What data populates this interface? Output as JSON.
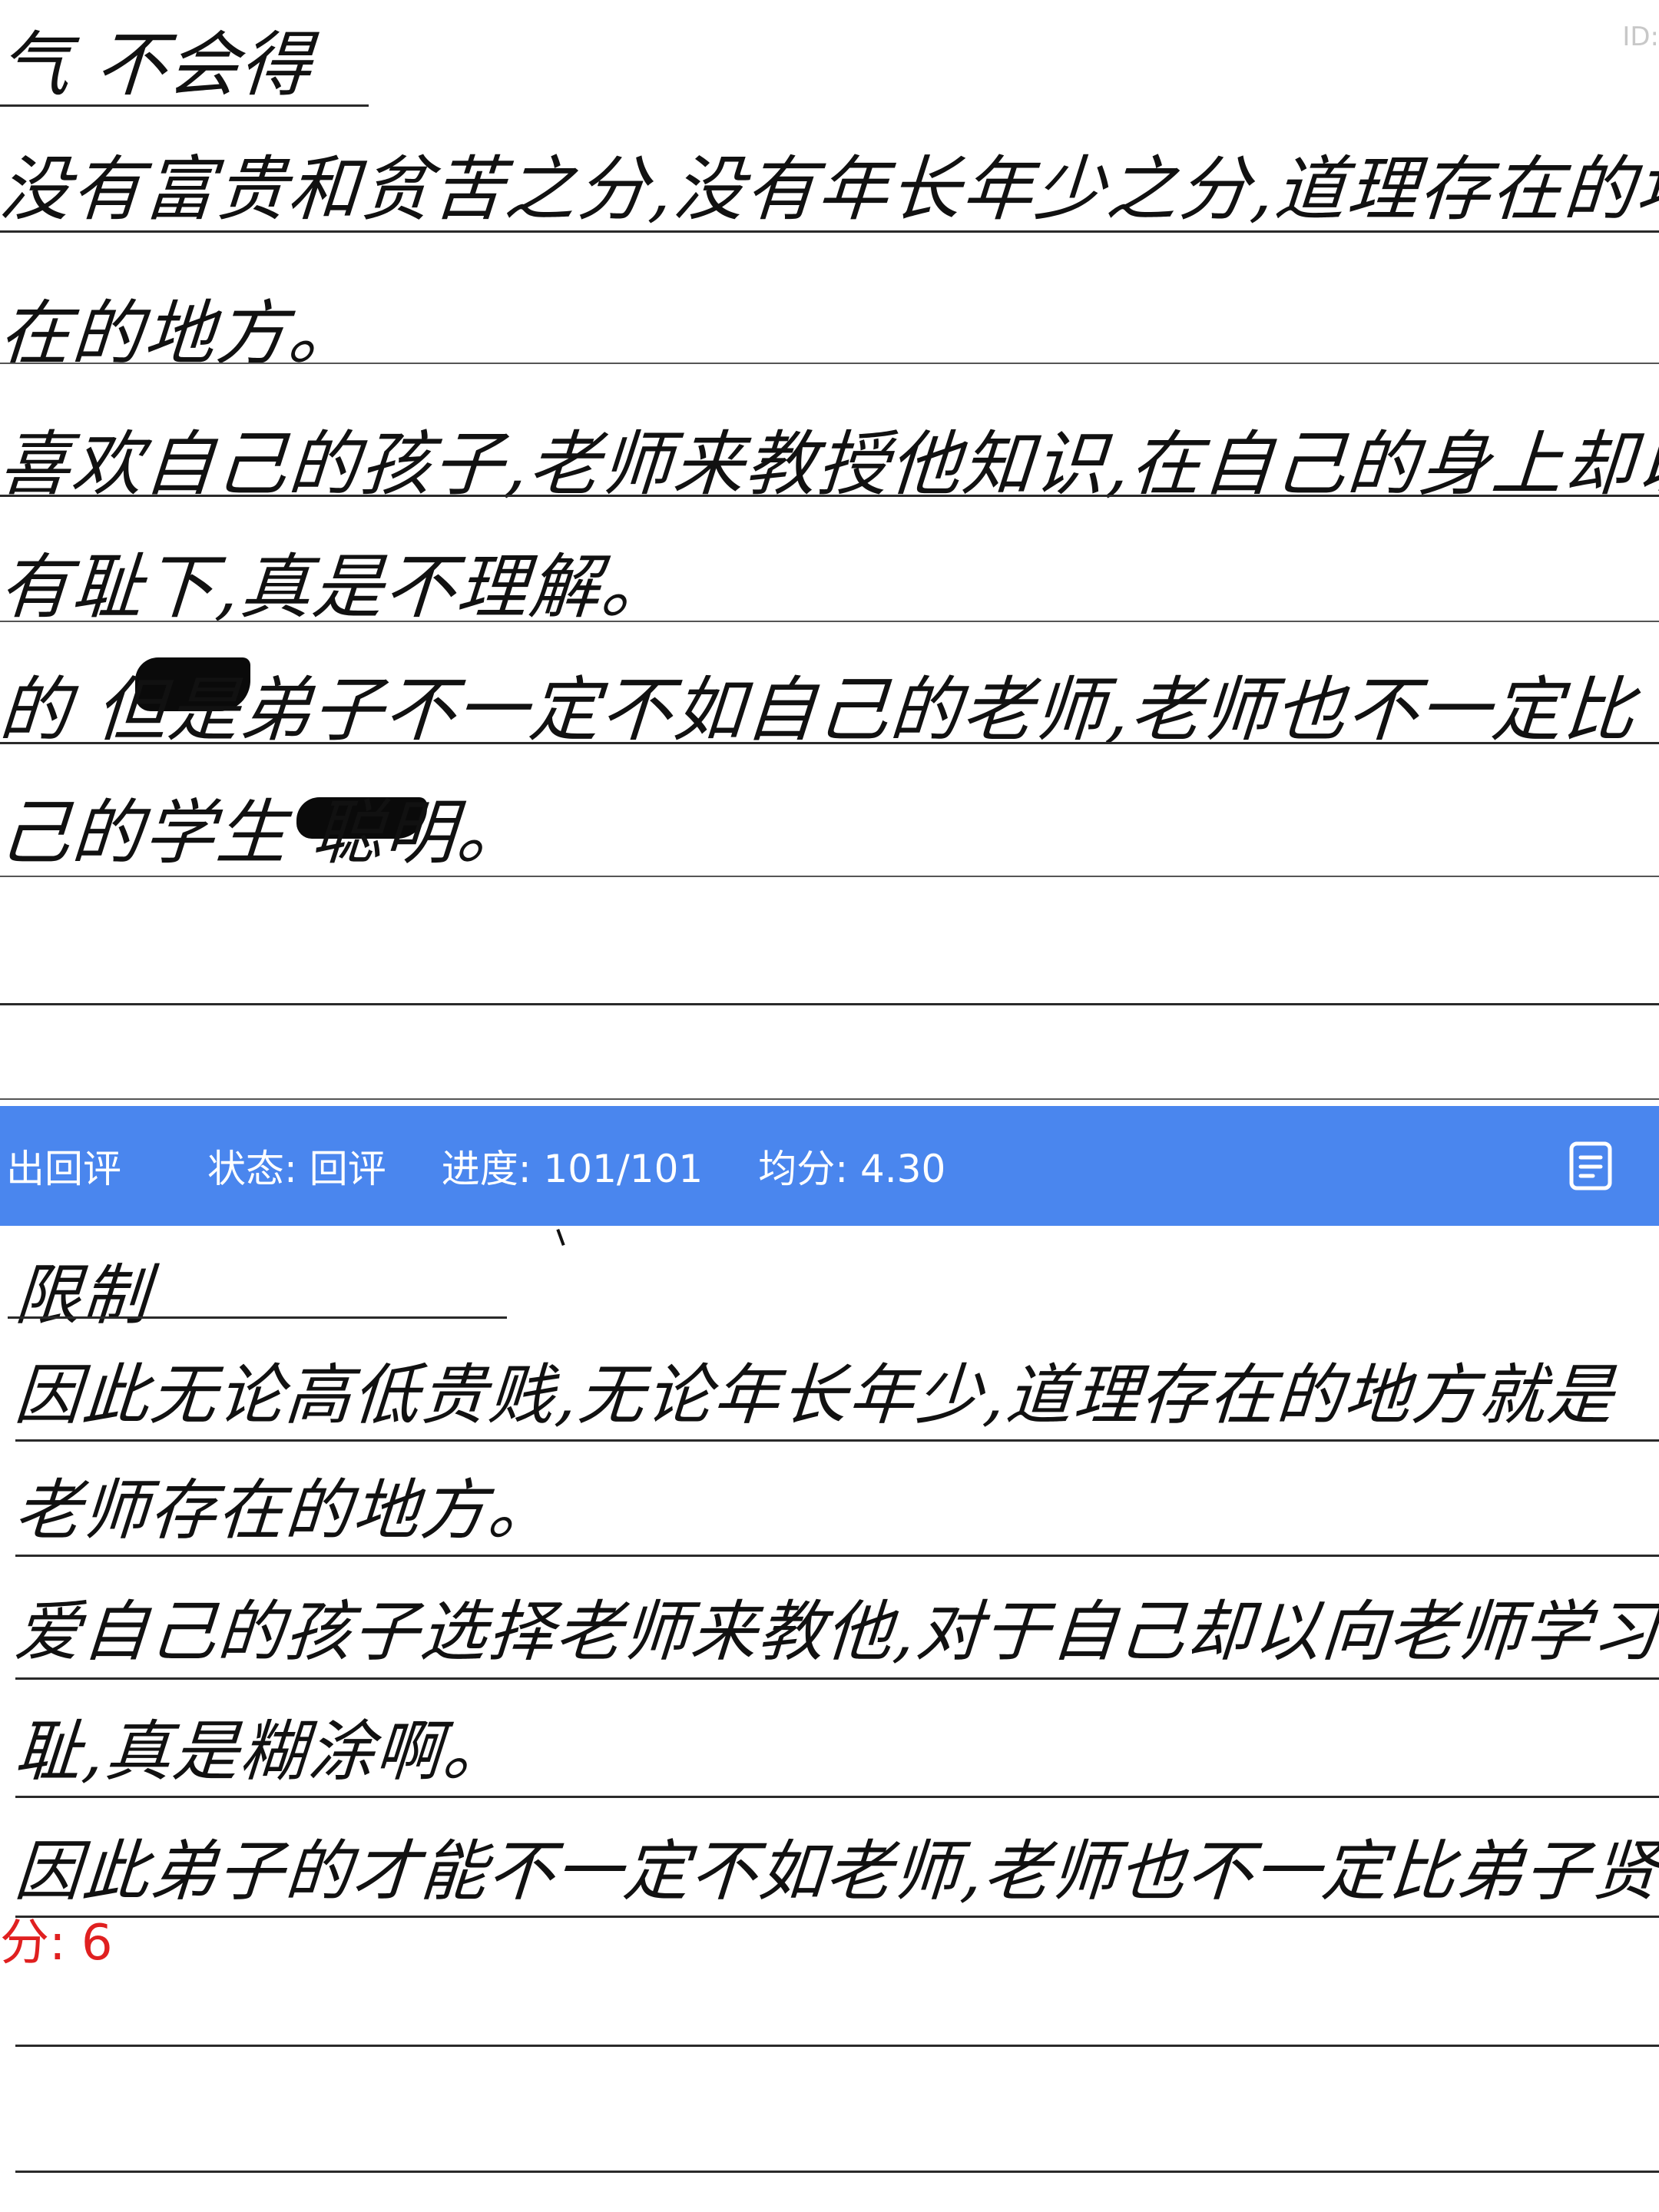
{
  "toolbar": {
    "title": "出回评",
    "status": "状态: 回评",
    "progress": "进度: 101/101",
    "average": "均分: 4.30",
    "doc_icon": "document-icon",
    "bar_color": "#4a86ee"
  },
  "id_label": "ID:",
  "answer_top": {
    "line1": "气 不会得",
    "line2": "没有富贵和贫苦之分,没有年长年少之分,道理存在的地方也就是老",
    "line3": "在的地方。",
    "line4": "喜欢自己的孩子,老师来教授他知识,在自己的身上却以在老",
    "line5": "有耻下,真是不理解。",
    "line6": "的 但是弟子不一定不如自己的老师,老师也不一定比",
    "line7": "己的学生 聪明。"
  },
  "answer_bottom": {
    "line1": "限制",
    "line2": "因此无论高低贵贱,无论年长年少,道理存在的地方就是",
    "line3": "老师存在的地方。",
    "line4": "爱自己的孩子选择老师来教他,对于自己却以向老师学习为",
    "line5": "耻,真是糊涂啊。",
    "line6": "因此弟子的才能不一定不如老师,老师也不一定比弟子贤能"
  },
  "score": {
    "label": "分: 6",
    "color": "#e02020"
  }
}
